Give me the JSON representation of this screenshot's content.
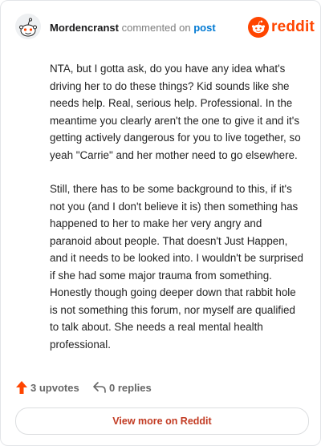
{
  "header": {
    "username": "Mordencranst",
    "action_text": "commented on",
    "target_text": "post",
    "brand_name": "reddit",
    "avatar_icon": "reddit-snoo-avatar-icon",
    "brand_icon": "reddit-logo-icon"
  },
  "comment": {
    "paragraphs": [
      "NTA, but I gotta ask, do you have any idea what's driving her to do these things? Kid sounds like she needs help. Real, serious help. Professional. In the meantime you clearly aren't the one to give it and it's getting actively dangerous for you to live together, so yeah \"Carrie\" and her mother need to go elsewhere.",
      "Still, there has to be some background to this, if it's not you (and I don't believe it is) then something has happened to her to make her very angry and paranoid about people. That doesn't Just Happen, and it needs to be looked into. I wouldn't be surprised if she had some major trauma from something. Honestly though going deeper down that rabbit hole is not something this forum, nor myself are qualified to talk about. She needs a real mental health professional."
    ]
  },
  "footer": {
    "upvotes_label": "3 upvotes",
    "replies_label": "0 replies",
    "upvote_icon": "upvote-arrow-icon",
    "reply_icon": "reply-arrow-icon"
  },
  "cta": {
    "view_more_label": "View more on Reddit"
  },
  "colors": {
    "brand": "#ff4500",
    "link": "#0079d3",
    "cta_text": "#c23b23"
  }
}
